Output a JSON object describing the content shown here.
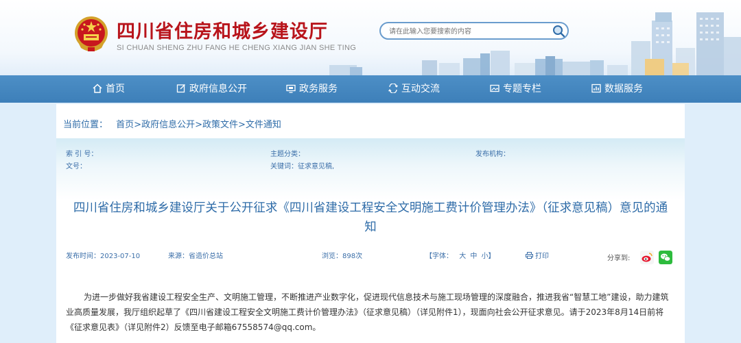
{
  "header": {
    "title": "四川省住房和城乡建设厅",
    "subtitle": "SI CHUAN SHENG ZHU FANG HE CHENG XIANG JIAN SHE TING",
    "search_placeholder": "请在此输入您要搜索的内容"
  },
  "nav": {
    "items": [
      {
        "label": "首页",
        "icon": "home-icon"
      },
      {
        "label": "政府信息公开",
        "icon": "edit-icon"
      },
      {
        "label": "政务服务",
        "icon": "monitor-icon"
      },
      {
        "label": "互动交流",
        "icon": "exchange-icon"
      },
      {
        "label": "专题专栏",
        "icon": "picture-icon"
      },
      {
        "label": "数据服务",
        "icon": "chart-icon"
      }
    ]
  },
  "breadcrumb": {
    "prefix": "当前位置：",
    "items": [
      "首页",
      "政府信息公开",
      "政策文件",
      "文件通知"
    ],
    "separator": ">"
  },
  "meta": {
    "index_label": "索 引 号：",
    "doc_no_label": "文号：",
    "topic_label": "主题分类：",
    "keywords_label": "关键词：",
    "keywords_value": "征求意见稿,",
    "publisher_label": "发布机构："
  },
  "article": {
    "title": "四川省住房和城乡建设厅关于公开征求《四川省建设工程安全文明施工费计价管理办法》（征求意见稿）意见的通知",
    "date": "发布时间：2023-07-10",
    "source": "来源：省造价总站",
    "views": "浏览：898次",
    "font_size_label": "【字体：",
    "font_large": "大",
    "font_medium": "中",
    "font_small": "小】",
    "print_label": "打印",
    "share_label": "分享到:",
    "body": "为进一步做好我省建设工程安全生产、文明施工管理，不断推进产业数字化，促进现代信息技术与施工现场管理的深度融合，推进我省“智慧工地”建设，助力建筑业高质量发展，我厅组织起草了《四川省建设工程安全文明施工费计价管理办法》（征求意见稿）（详见附件1），现面向社会公开征求意见。请于2023年8月14日前将《征求意见表》（详见附件2）反馈至电子邮箱67558574@qq.com。"
  },
  "colors": {
    "brand_red": "#b8141b",
    "nav_blue": "#4389c3",
    "link_blue": "#2f6ca8"
  }
}
